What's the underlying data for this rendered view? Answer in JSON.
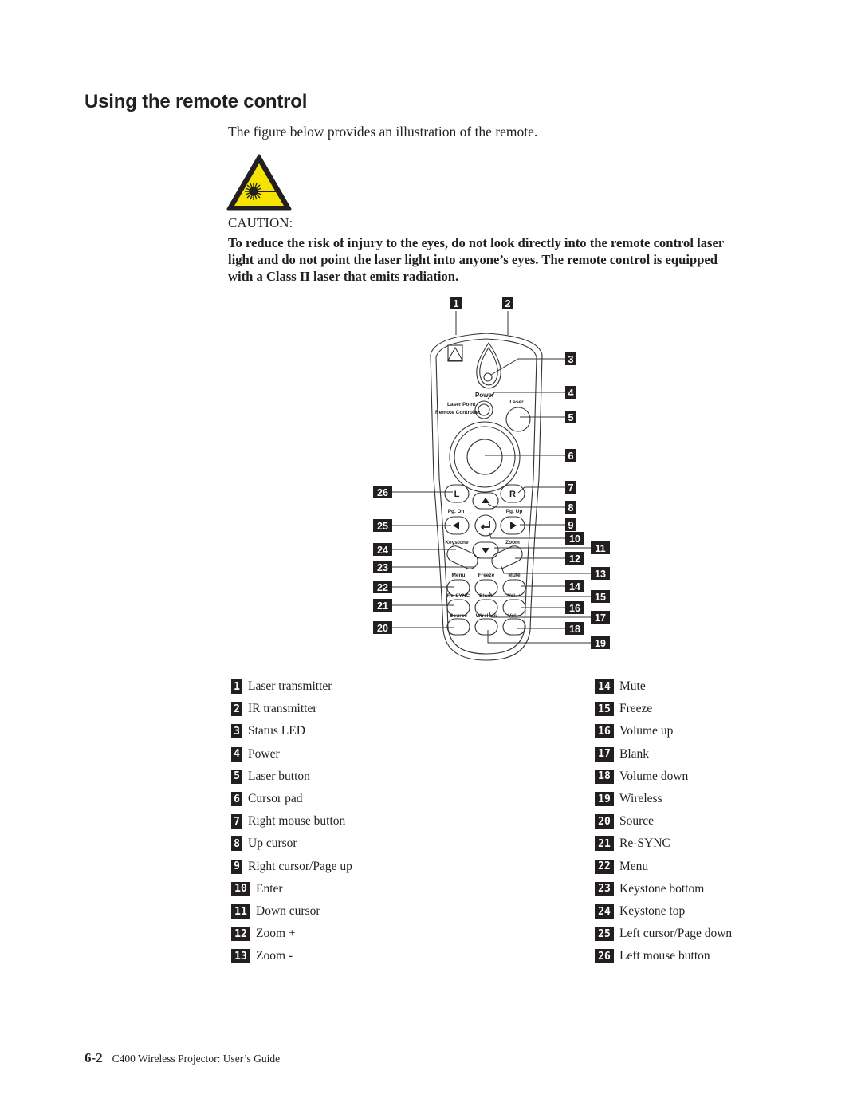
{
  "header": {
    "title": "Using the remote control"
  },
  "intro": "The figure below provides an illustration of the remote.",
  "caution": {
    "icon": "laser-warning-icon",
    "icon_color": "#f4e400",
    "heading": "CAUTION:",
    "text": "To reduce the risk of injury to the eyes, do not look directly into the remote control laser light and do not point the laser light into anyone’s eyes. The remote control is equipped with a Class II laser that emits radiation."
  },
  "remote_figure": {
    "labels": {
      "power": "Power",
      "laser_point": "Laser Point",
      "remote_controller": "Remote Controller",
      "laser": "Laser",
      "l": "L",
      "r": "R",
      "pg_dn": "Pg. Dn",
      "pg_up": "Pg. Up",
      "keystone": "Keystone",
      "zoom": "Zoom",
      "menu": "Menu",
      "freeze": "Freeze",
      "mute": "Mute",
      "resync": "Re-SYNC",
      "blank": "Blank",
      "vol_up": "Vol. +",
      "source": "Source",
      "wireless": "Wireless",
      "vol_down": "Vol. -"
    },
    "callouts": [
      "1",
      "2",
      "3",
      "4",
      "5",
      "6",
      "7",
      "8",
      "9",
      "10",
      "11",
      "12",
      "13",
      "14",
      "15",
      "16",
      "17",
      "18",
      "19",
      "20",
      "21",
      "22",
      "23",
      "24",
      "25",
      "26"
    ]
  },
  "legend": {
    "left": [
      {
        "num": "1",
        "label": "Laser transmitter"
      },
      {
        "num": "2",
        "label": "IR transmitter"
      },
      {
        "num": "3",
        "label": "Status LED"
      },
      {
        "num": "4",
        "label": "Power"
      },
      {
        "num": "5",
        "label": "Laser button"
      },
      {
        "num": "6",
        "label": "Cursor pad"
      },
      {
        "num": "7",
        "label": "Right mouse button"
      },
      {
        "num": "8",
        "label": "Up cursor"
      },
      {
        "num": "9",
        "label": "Right cursor/Page up"
      },
      {
        "num": "10",
        "label": "Enter"
      },
      {
        "num": "11",
        "label": "Down cursor"
      },
      {
        "num": "12",
        "label": "Zoom +"
      },
      {
        "num": "13",
        "label": "Zoom -"
      }
    ],
    "right": [
      {
        "num": "14",
        "label": "Mute"
      },
      {
        "num": "15",
        "label": "Freeze"
      },
      {
        "num": "16",
        "label": "Volume up"
      },
      {
        "num": "17",
        "label": "Blank"
      },
      {
        "num": "18",
        "label": "Volume down"
      },
      {
        "num": "19",
        "label": "Wireless"
      },
      {
        "num": "20",
        "label": "Source"
      },
      {
        "num": "21",
        "label": "Re-SYNC"
      },
      {
        "num": "22",
        "label": "Menu"
      },
      {
        "num": "23",
        "label": "Keystone bottom"
      },
      {
        "num": "24",
        "label": "Keystone top"
      },
      {
        "num": "25",
        "label": "Left cursor/Page down"
      },
      {
        "num": "26",
        "label": "Left mouse button"
      }
    ]
  },
  "footer": {
    "page": "6-2",
    "doc_title": "C400 Wireless Projector: User’s Guide"
  }
}
